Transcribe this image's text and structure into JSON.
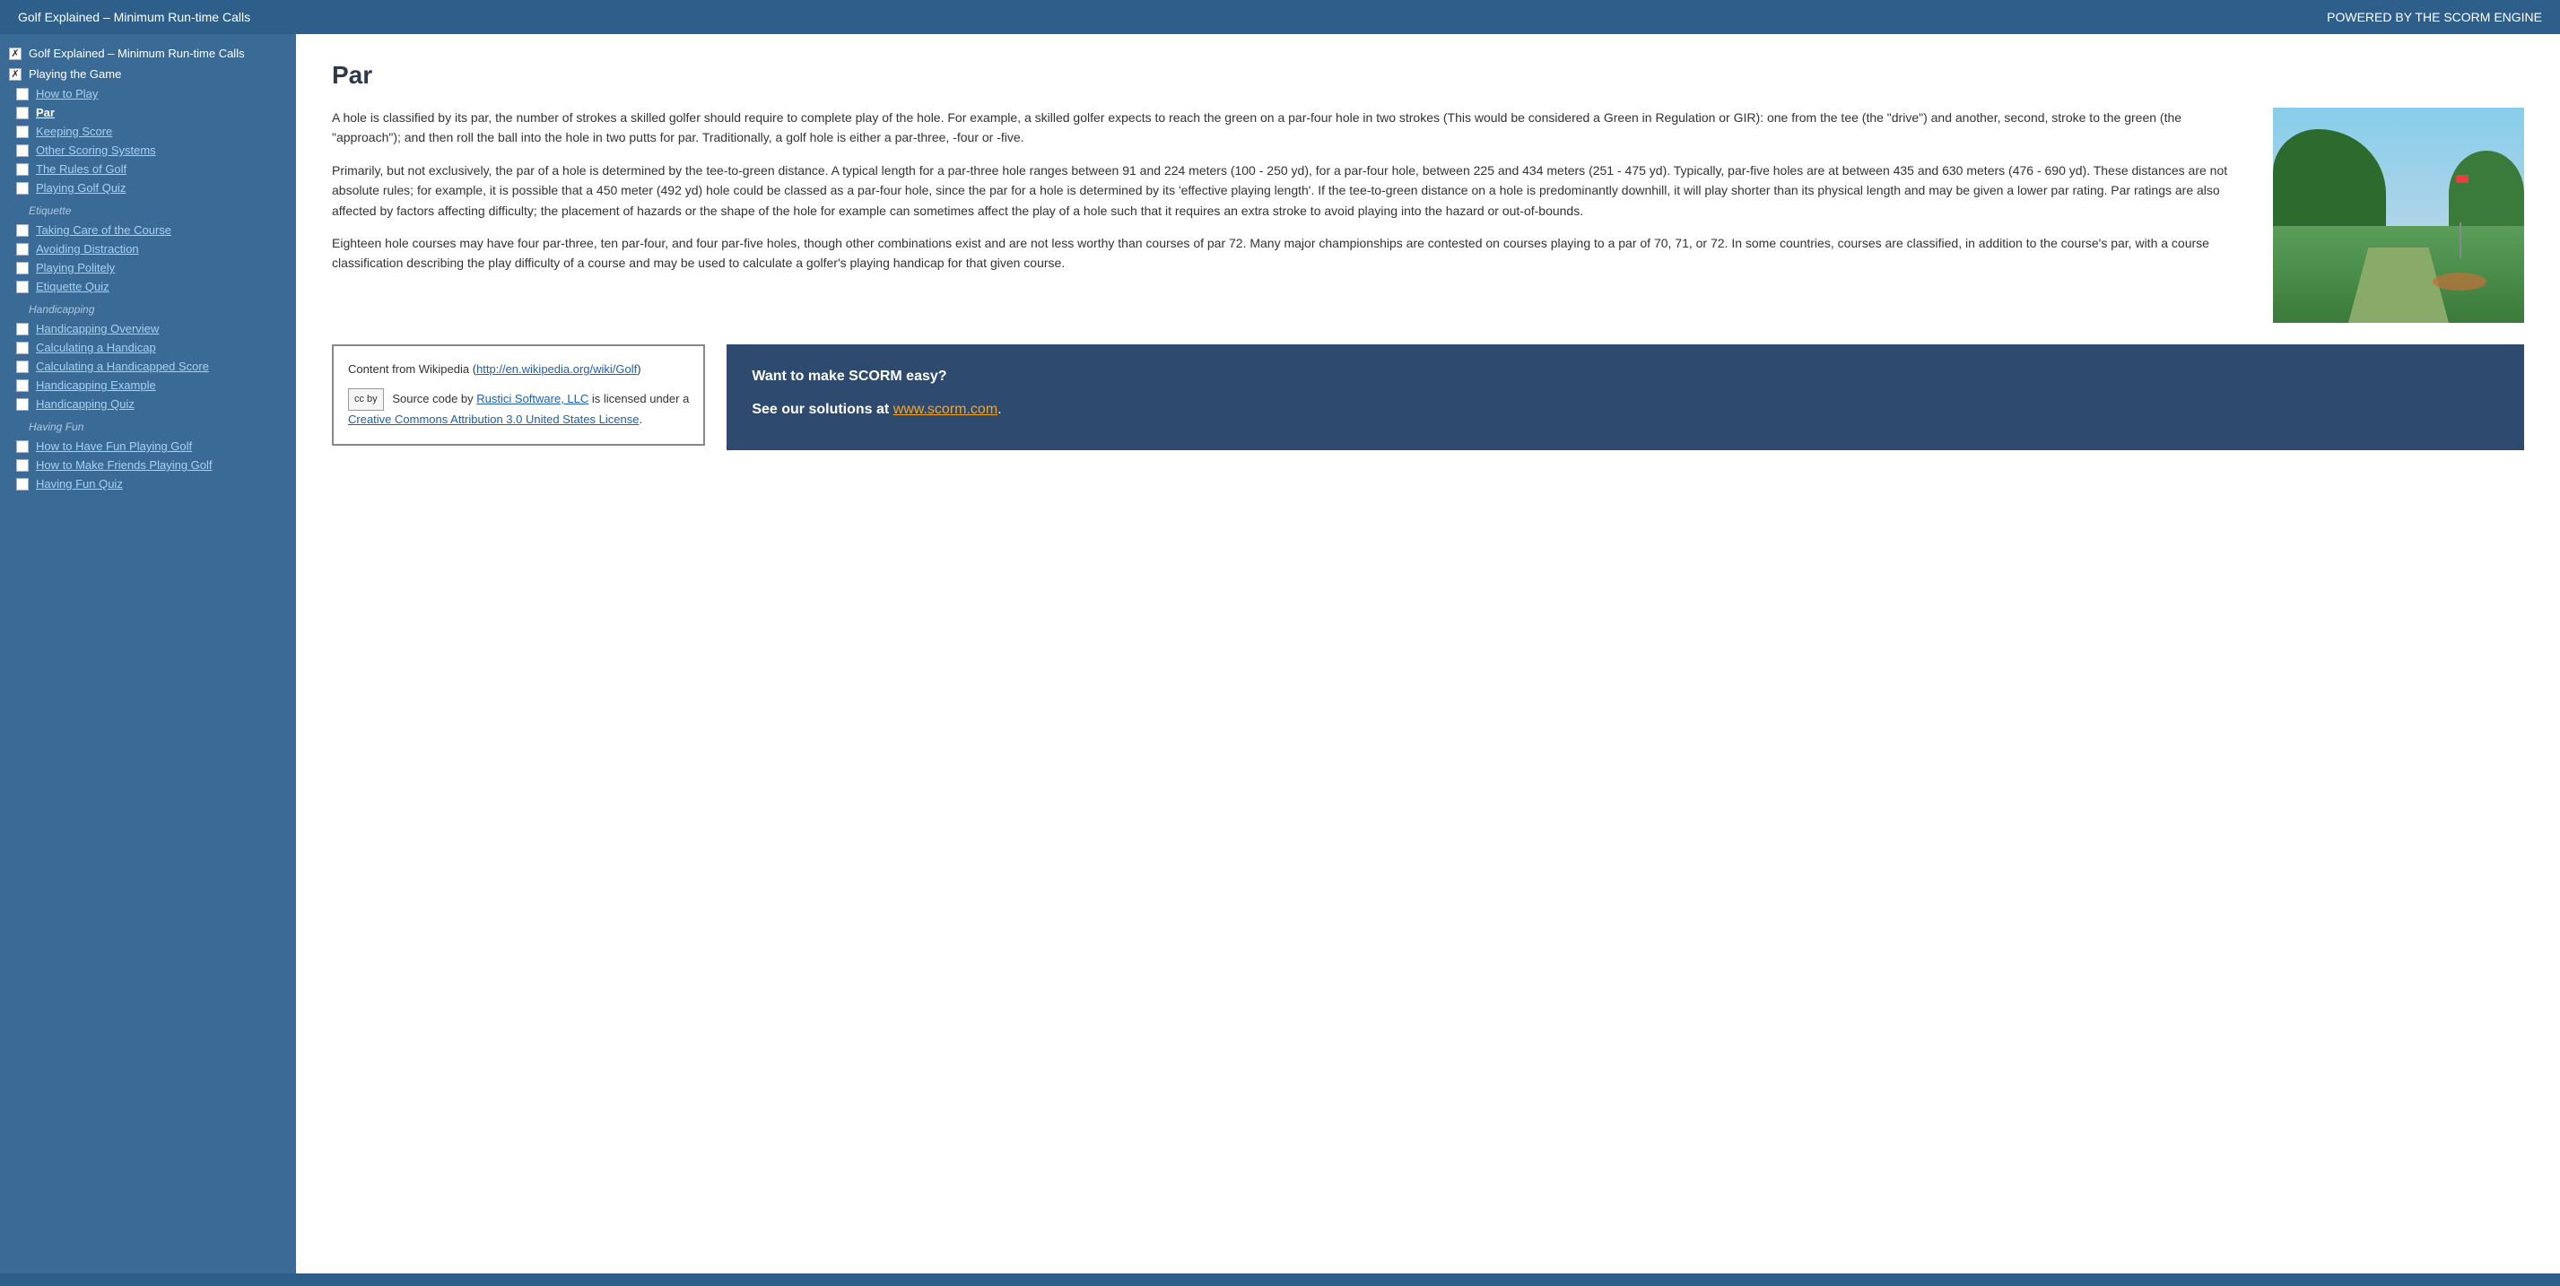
{
  "topBar": {
    "title": "Golf Explained – Minimum Run-time Calls",
    "powered": "POWERED BY THE SCORM ENGINE"
  },
  "sidebar": {
    "rootItems": [
      {
        "id": "root-golf-explained",
        "label": "Golf Explained – Minimum Run-time Calls",
        "checkState": "x"
      },
      {
        "id": "root-playing-the-game",
        "label": "Playing the Game",
        "checkState": "x"
      }
    ],
    "sections": [
      {
        "id": "section-playing",
        "label": "",
        "items": [
          {
            "id": "how-to-play",
            "label": "How to Play",
            "checkState": "checked",
            "active": false
          },
          {
            "id": "par",
            "label": "Par",
            "checkState": "empty",
            "active": true
          },
          {
            "id": "keeping-score",
            "label": "Keeping Score",
            "checkState": "empty",
            "active": false
          },
          {
            "id": "other-scoring-systems",
            "label": "Other Scoring Systems",
            "checkState": "empty",
            "active": false
          },
          {
            "id": "rules-of-golf",
            "label": "The Rules of Golf",
            "checkState": "empty",
            "active": false
          },
          {
            "id": "playing-golf-quiz",
            "label": "Playing Golf Quiz",
            "checkState": "empty",
            "active": false
          }
        ]
      },
      {
        "id": "section-etiquette",
        "label": "Etiquette",
        "items": [
          {
            "id": "taking-care",
            "label": "Taking Care of the Course",
            "checkState": "empty",
            "active": false
          },
          {
            "id": "avoiding-distraction",
            "label": "Avoiding Distraction",
            "checkState": "empty",
            "active": false
          },
          {
            "id": "playing-politely",
            "label": "Playing Politely",
            "checkState": "empty",
            "active": false
          },
          {
            "id": "etiquette-quiz",
            "label": "Etiquette Quiz",
            "checkState": "empty",
            "active": false
          }
        ]
      },
      {
        "id": "section-handicapping",
        "label": "Handicapping",
        "items": [
          {
            "id": "handicapping-overview",
            "label": "Handicapping Overview",
            "checkState": "empty",
            "active": false
          },
          {
            "id": "calculating-handicap",
            "label": "Calculating a Handicap",
            "checkState": "empty",
            "active": false
          },
          {
            "id": "calculating-handicapped-score",
            "label": "Calculating a Handicapped Score",
            "checkState": "empty",
            "active": false
          },
          {
            "id": "handicapping-example",
            "label": "Handicapping Example",
            "checkState": "empty",
            "active": false
          },
          {
            "id": "handicapping-quiz",
            "label": "Handicapping Quiz",
            "checkState": "empty",
            "active": false
          }
        ]
      },
      {
        "id": "section-having-fun",
        "label": "Having Fun",
        "items": [
          {
            "id": "how-to-have-fun",
            "label": "How to Have Fun Playing Golf",
            "checkState": "empty",
            "active": false
          },
          {
            "id": "how-to-make-friends",
            "label": "How to Make Friends Playing Golf",
            "checkState": "empty",
            "active": false
          },
          {
            "id": "having-fun-quiz",
            "label": "Having Fun Quiz",
            "checkState": "empty",
            "active": false
          }
        ]
      }
    ]
  },
  "main": {
    "pageTitle": "Par",
    "paragraphs": [
      "A hole is classified by its par, the number of strokes a skilled golfer should require to complete play of the hole. For example, a skilled golfer expects to reach the green on a par-four hole in two strokes (This would be considered a Green in Regulation or GIR): one from the tee (the \"drive\") and another, second, stroke to the green (the \"approach\"); and then roll the ball into the hole in two putts for par. Traditionally, a golf hole is either a par-three, -four or -five.",
      "Primarily, but not exclusively, the par of a hole is determined by the tee-to-green distance. A typical length for a par-three hole ranges between 91 and 224 meters (100 - 250 yd), for a par-four hole, between 225 and 434 meters (251 - 475 yd). Typically, par-five holes are at between 435 and 630 meters (476 - 690 yd). These distances are not absolute rules; for example, it is possible that a 450 meter (492 yd) hole could be classed as a par-four hole, since the par for a hole is determined by its 'effective playing length'. If the tee-to-green distance on a hole is predominantly downhill, it will play shorter than its physical length and may be given a lower par rating. Par ratings are also affected by factors affecting difficulty; the placement of hazards or the shape of the hole for example can sometimes affect the play of a hole such that it requires an extra stroke to avoid playing into the hazard or out-of-bounds.",
      "Eighteen hole courses may have four par-three, ten par-four, and four par-five holes, though other combinations exist and are not less worthy than courses of par 72. Many major championships are contested on courses playing to a par of 70, 71, or 72. In some countries, courses are classified, in addition to the course's par, with a course classification describing the play difficulty of a course and may be used to calculate a golfer's playing handicap for that given course."
    ],
    "wikipedia": {
      "prefix": "Content from Wikipedia (",
      "linkText": "http://en.wikipedia.org/wiki/Golf",
      "linkUrl": "http://en.wikipedia.org/wiki/Golf",
      "suffix": ")",
      "ccText": "Source code by",
      "ccLinkText": "Rustici Software, LLC",
      "ccLinkUrl": "http://www.rustici.com",
      "ccSuffix": "is licensed under a",
      "ccLicenseText": "Creative Commons Attribution 3.0 United States License",
      "ccLicenseUrl": "http://creativecommons.org/licenses/by/3.0/us/",
      "ccEnd": "."
    },
    "scorm": {
      "line1": "Want to make SCORM easy?",
      "line2": "See our solutions at",
      "linkText": "www.scorm.com",
      "linkUrl": "http://www.scorm.com",
      "suffix": "."
    }
  }
}
